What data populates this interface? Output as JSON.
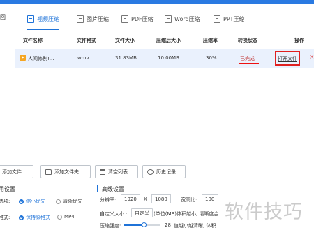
{
  "nav": {
    "back": "回"
  },
  "tabs": [
    {
      "label": "视频压缩"
    },
    {
      "label": "图片压缩"
    },
    {
      "label": "PDF压缩"
    },
    {
      "label": "Word压缩"
    },
    {
      "label": "PPT压缩"
    }
  ],
  "table": {
    "headers": [
      "文件名称",
      "文件格式",
      "文件大小",
      "压缩后大小",
      "压缩率",
      "转换状态",
      "操作"
    ],
    "rows": [
      {
        "name": "人间修剧!...",
        "format": "wmv",
        "size": "31.83MB",
        "compressed": "10.00MB",
        "ratio": "30%",
        "status": "已完成",
        "action": "打开文件",
        "delete": "×"
      }
    ]
  },
  "toolbar": {
    "add_file": "添加文件",
    "add_folder": "添加文件夹",
    "clear": "清空列表",
    "history": "历史记录"
  },
  "settings": {
    "title": "用设置",
    "priority_label": "选项:",
    "priority_options": [
      "缩小优先",
      "清晰优先"
    ],
    "format_label": "格式:",
    "format_options": [
      "保持原格式",
      "MP4"
    ]
  },
  "advanced": {
    "title": "高级设置",
    "resolution_label": "分辨率:",
    "res_w": "1920",
    "res_x": "X",
    "res_h": "1080",
    "aspect_label": "宽高比:",
    "aspect_value": "100",
    "custom_label": "自定义大小 :",
    "custom_button": "自定义",
    "custom_hint": "(单位(MB)体积越小, 清晰度会",
    "strength_label": "压缩强度:",
    "strength_value": "28",
    "strength_hint": "值越小越清晰, 体积",
    "strength_fraction": 0.55
  },
  "watermark": "软件技巧",
  "colors": {
    "accent": "#1f73d8",
    "highlight": "#e02020",
    "row_bg": "#eaf1fd"
  }
}
